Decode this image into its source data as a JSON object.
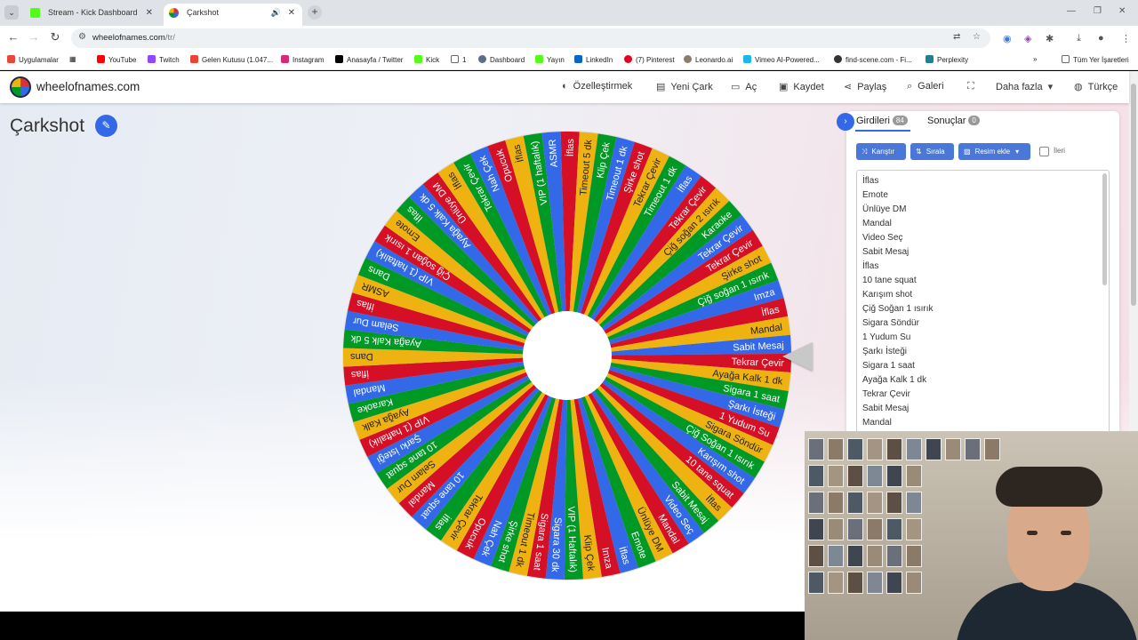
{
  "browser": {
    "tabs": [
      {
        "title": "Stream - Kick Dashboard",
        "active": false,
        "favicon_color": "#53fc18"
      },
      {
        "title": "Çarkshot",
        "active": true,
        "favicon_color": "#3369e8"
      }
    ],
    "url_host": "wheelofnames.com",
    "url_path": "/tr/",
    "bookmarks": [
      {
        "label": "Uygulamalar",
        "color": "#e8453c"
      },
      {
        "label": "YouTube",
        "color": "#ff0000"
      },
      {
        "label": "Twitch",
        "color": "#9146ff"
      },
      {
        "label": "Gelen Kutusu (1.047...",
        "color": "#ea4335"
      },
      {
        "label": "Instagram",
        "color": "#d62976"
      },
      {
        "label": "Anasayfa / Twitter",
        "color": "#000000"
      },
      {
        "label": "Kick",
        "color": "#53fc18"
      },
      {
        "label": "1",
        "color": "#666666"
      },
      {
        "label": "Dashboard",
        "color": "#5b6c8f"
      },
      {
        "label": "Yayın",
        "color": "#53fc18"
      },
      {
        "label": "LinkedIn",
        "color": "#0a66c2"
      },
      {
        "label": "(7) Pinterest",
        "color": "#e60023"
      },
      {
        "label": "Leonardo.ai",
        "color": "#8a7d6a"
      },
      {
        "label": "Vimeo AI-Powered...",
        "color": "#1ab7ea"
      },
      {
        "label": "find-scene.com - Fi...",
        "color": "#333333"
      },
      {
        "label": "Perplexity",
        "color": "#20808d"
      }
    ],
    "all_bookmarks": "Tüm Yer İşaretleri"
  },
  "site": {
    "name": "wheelofnames.com",
    "menu": [
      {
        "label": "Özelleştirmek",
        "icon": "palette-icon",
        "glyph": "🎨"
      },
      {
        "label": "Yeni Çark",
        "icon": "file-icon",
        "glyph": "📄"
      },
      {
        "label": "Aç",
        "icon": "folder-icon",
        "glyph": "📂"
      },
      {
        "label": "Kaydet",
        "icon": "save-icon",
        "glyph": "💾"
      },
      {
        "label": "Paylaş",
        "icon": "share-icon",
        "glyph": "⤴"
      },
      {
        "label": "Galeri",
        "icon": "search-icon",
        "glyph": "🔍"
      },
      {
        "label": "",
        "icon": "fullscreen-icon",
        "glyph": "⛶"
      },
      {
        "label": "Daha fazla",
        "icon": "caret-down-icon",
        "glyph": "▾"
      },
      {
        "label": "Türkçe",
        "icon": "globe-icon",
        "glyph": "🌐"
      }
    ]
  },
  "wheel": {
    "title": "Çarkshot",
    "colors": [
      "#3369e8",
      "#d50f25",
      "#eeb211",
      "#009925"
    ],
    "segments": [
      "Sabit Mesaj",
      "Tekrar Çevir",
      "Ayağa Kalk 1 dk",
      "Sigara 1 saat",
      "Şarkı İsteği",
      "1 Yudum Su",
      "Sigara Söndür",
      "Çiğ Soğan 1 ısırık",
      "Karışım shot",
      "10 tane squat",
      "İflas",
      "Sabit Mesaj",
      "Video Seç",
      "Mandal",
      "Ünlüye DM",
      "Emote",
      "İflas",
      "Imza",
      "Klip Çek",
      "VIP (1 Haftalık)",
      "Sigara 30 dk",
      "Sigara 1 saat",
      "Timeout 1 dk",
      "Şirke shot",
      "Nah Çek",
      "Opucuk",
      "Tekrar Çevir",
      "İflas",
      "10 tane squat",
      "Mandal",
      "Selam Dur",
      "10 tane squat",
      "Şarkı İsteği",
      "VIP (1 haftalık)",
      "Ayağa Kalk",
      "Karaoke",
      "Mandal",
      "İflas",
      "Dans",
      "Ayağa Kalk 5 dk",
      "Selam Dur",
      "İflas",
      "ASMR",
      "Dans",
      "VIP (1 haftalık)",
      "Çiğ soğan 1 ısırık",
      "Emote",
      "İflas",
      "Ayağa Kalk 5 dk",
      "Ünlüye DM",
      "İflas",
      "Tekrar Çevir",
      "Nah Çek",
      "Opucuk",
      "İflas",
      "VIP (1 haftalık)",
      "ASMR",
      "İflas",
      "Timeout 5 dk",
      "Klip Çek",
      "Timeout 1 dk",
      "Şirke shot",
      "Tekrar Çevir",
      "Timeout 1 dk",
      "İflas",
      "Tekrar Çevir",
      "Çiğ soğan 2 ısırık",
      "Karaoke",
      "Tekrar Çevir",
      "Tekrar Çevir",
      "Şirke shot",
      "Çiğ soğan 1 ısırık",
      "Imza",
      "İflas",
      "Mandal"
    ]
  },
  "panel": {
    "tab_entries": "Girdileri",
    "entries_count": "84",
    "tab_results": "Sonuçlar",
    "results_count": "0",
    "btn_shuffle": "Karıştır",
    "btn_sort": "Sırala",
    "btn_image": "Resim ekle",
    "advanced": "İleri",
    "entries": [
      "İflas",
      "Emote",
      "Ünlüye DM",
      "Mandal",
      "Video Seç",
      "Sabit Mesaj",
      "İflas",
      "10 tane squat",
      "Karışım shot",
      "Çiğ Soğan 1 ısırık",
      "Sigara Söndür",
      "1 Yudum Su",
      "Şarkı İsteği",
      "Sigara 1 saat",
      "Ayağa Kalk 1 dk",
      "Tekrar Çevir",
      "Sabit Mesaj",
      "Mandal"
    ]
  }
}
